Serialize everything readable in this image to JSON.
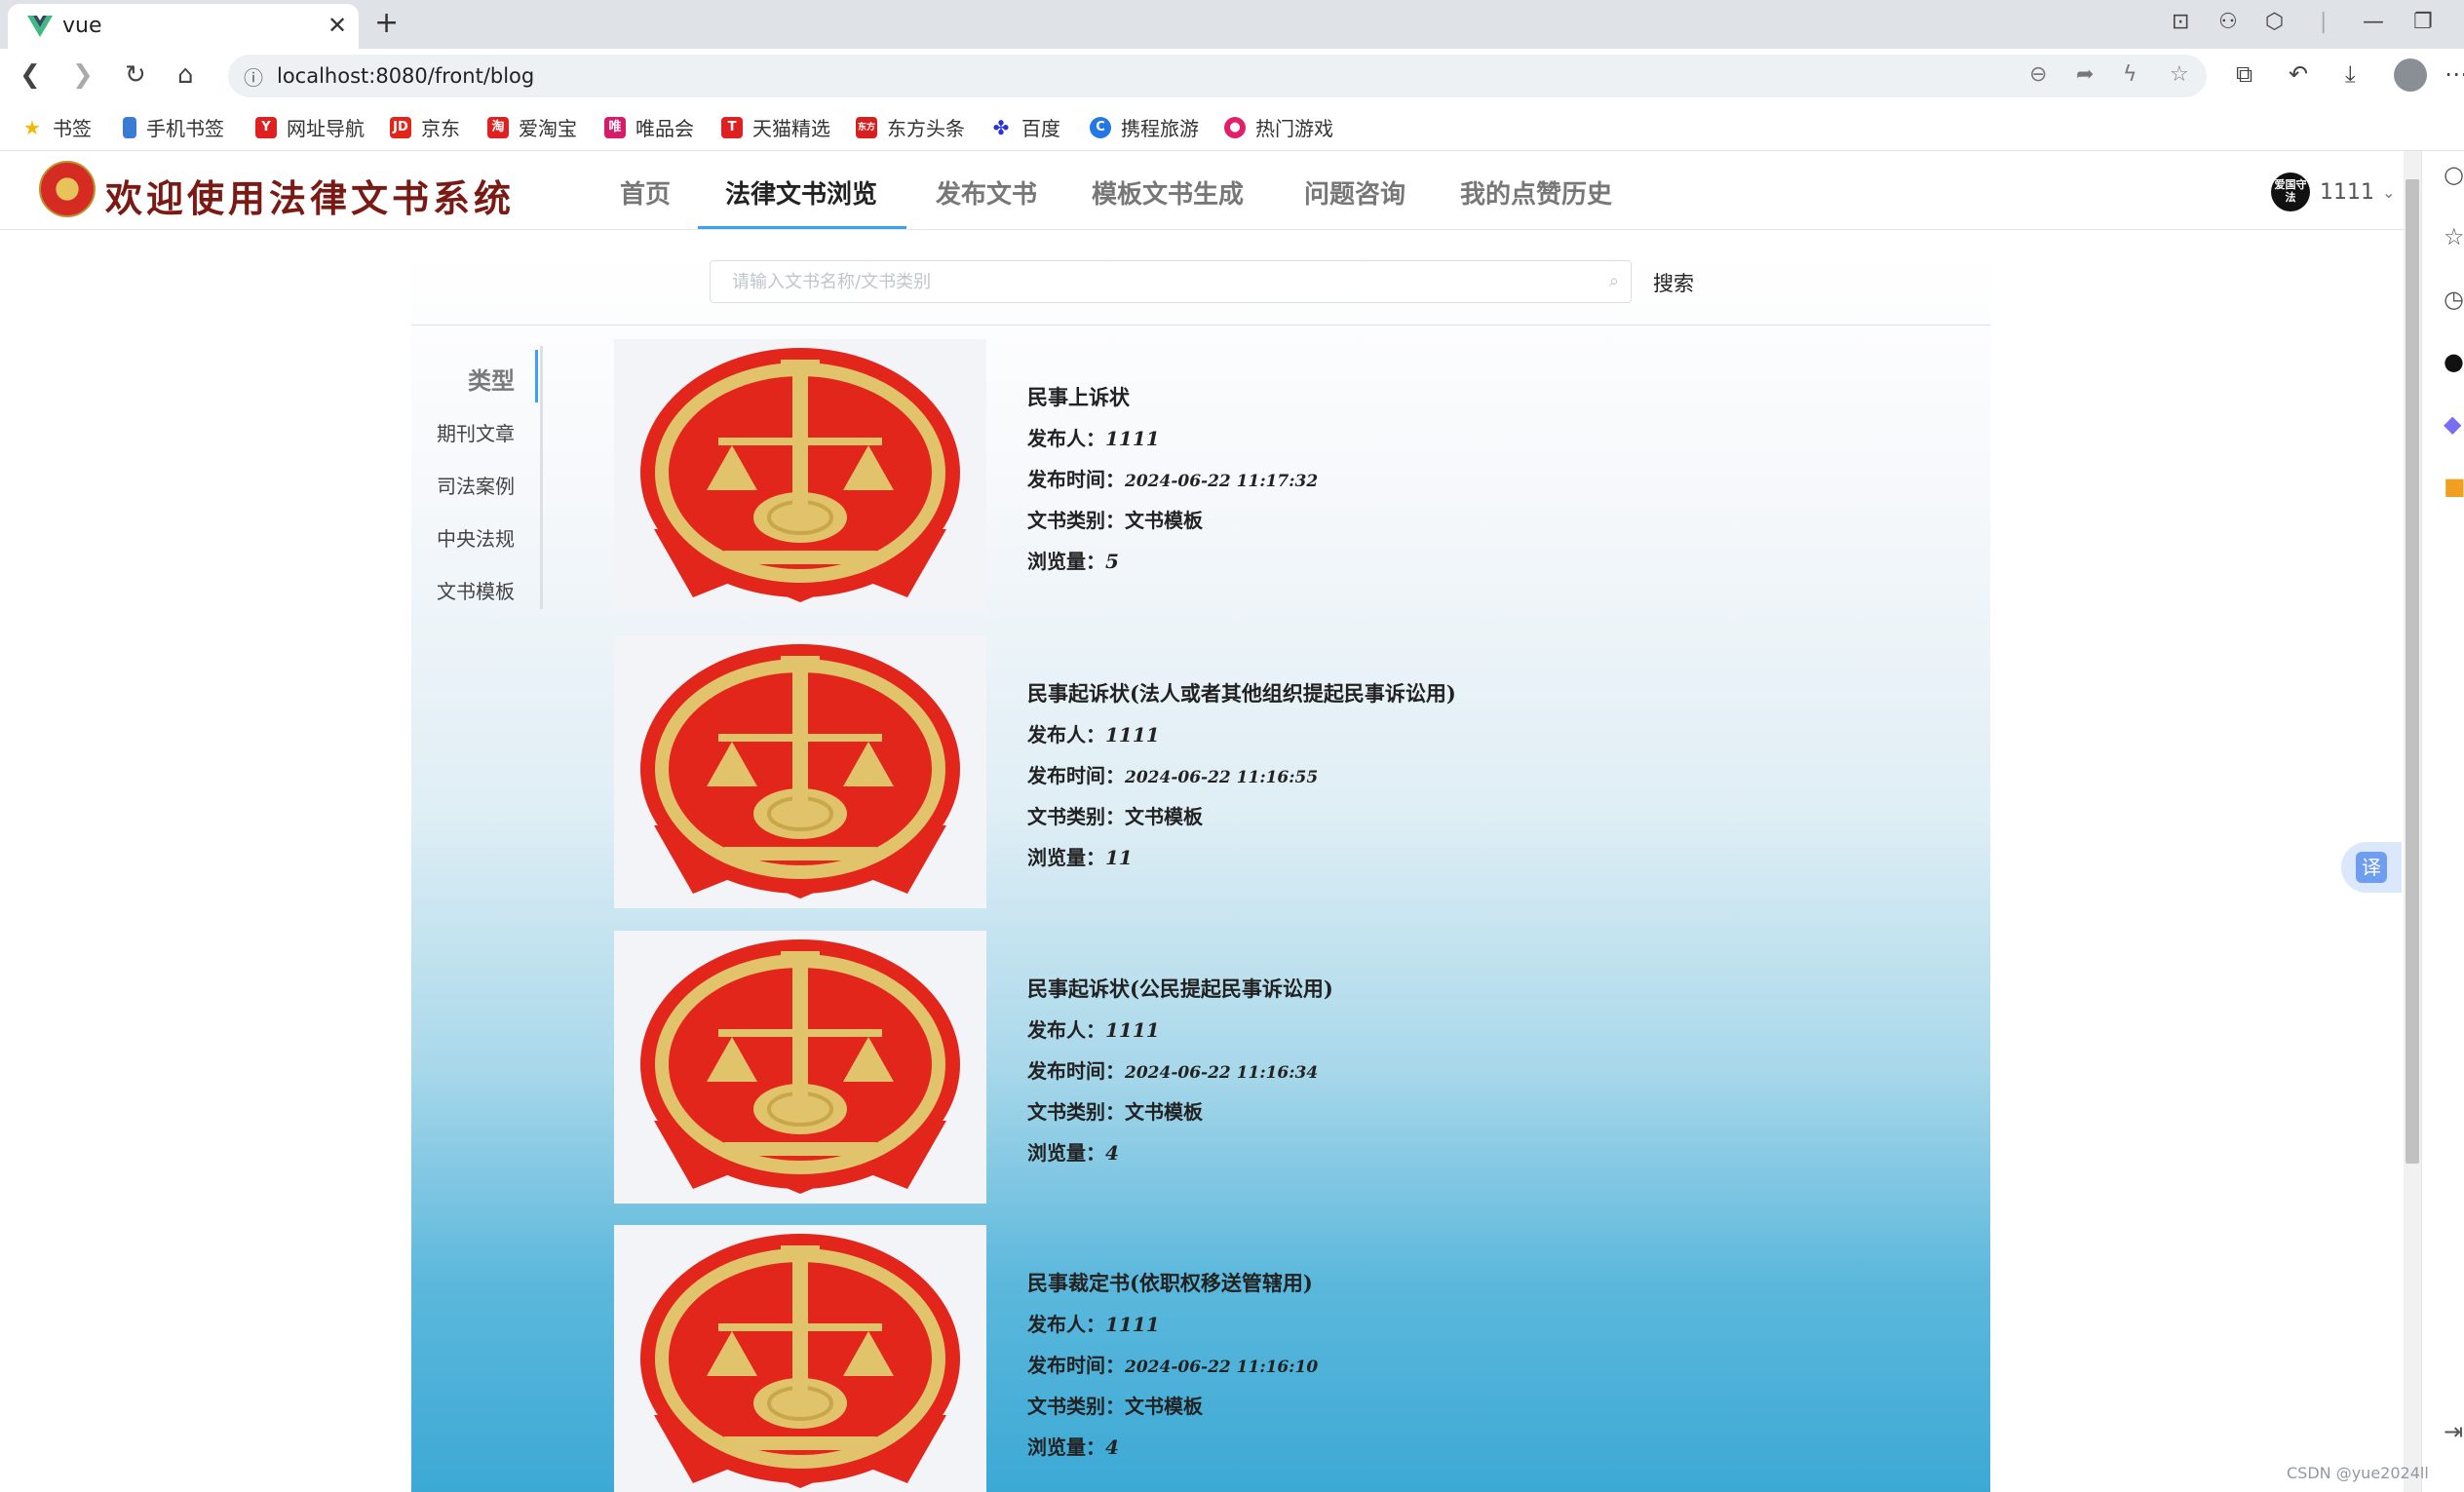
{
  "browser": {
    "tab_title": "vue",
    "url": "localhost:8080/front/blog",
    "bookmarks": [
      "书签",
      "手机书签",
      "网址导航",
      "京东",
      "爱淘宝",
      "唯品会",
      "天猫精选",
      "东方头条",
      "百度",
      "携程旅游",
      "热门游戏"
    ],
    "bookmark_colors": [
      "#f5b800",
      "#3a7bd5",
      "#e02020",
      "#e1251b",
      "#e02020",
      "#d61b6b",
      "#e02020",
      "#d62020",
      "#2932e1",
      "#2577e3",
      "#e0206b"
    ]
  },
  "site": {
    "title": "欢迎使用法律文书系统",
    "nav": [
      "首页",
      "法律文书浏览",
      "发布文书",
      "模板文书生成",
      "问题咨询",
      "我的点赞历史"
    ],
    "active_nav": "法律文书浏览",
    "user": {
      "avatar_text": "爱国守法",
      "name": "1111"
    }
  },
  "search": {
    "placeholder": "请输入文书名称/文书类别",
    "button": "搜索"
  },
  "sidebar": {
    "title": "类型",
    "items": [
      "期刊文章",
      "司法案例",
      "中央法规",
      "文书模板"
    ]
  },
  "labels": {
    "publisher": "发布人：",
    "time": "发布时间：",
    "category": "文书类别：",
    "views": "浏览量："
  },
  "documents": [
    {
      "title": "民事上诉状",
      "publisher": "1111",
      "time": "2024-06-22 11:17:32",
      "category": "文书模板",
      "views": "5"
    },
    {
      "title": "民事起诉状(法人或者其他组织提起民事诉讼用)",
      "publisher": "1111",
      "time": "2024-06-22 11:16:55",
      "category": "文书模板",
      "views": "11"
    },
    {
      "title": "民事起诉状(公民提起民事诉讼用)",
      "publisher": "1111",
      "time": "2024-06-22 11:16:34",
      "category": "文书模板",
      "views": "4"
    },
    {
      "title": "民事裁定书(依职权移送管辖用)",
      "publisher": "1111",
      "time": "2024-06-22 11:16:10",
      "category": "文书模板",
      "views": "4"
    }
  ],
  "translate_label": "译",
  "watermark": "CSDN @yue2024ll"
}
